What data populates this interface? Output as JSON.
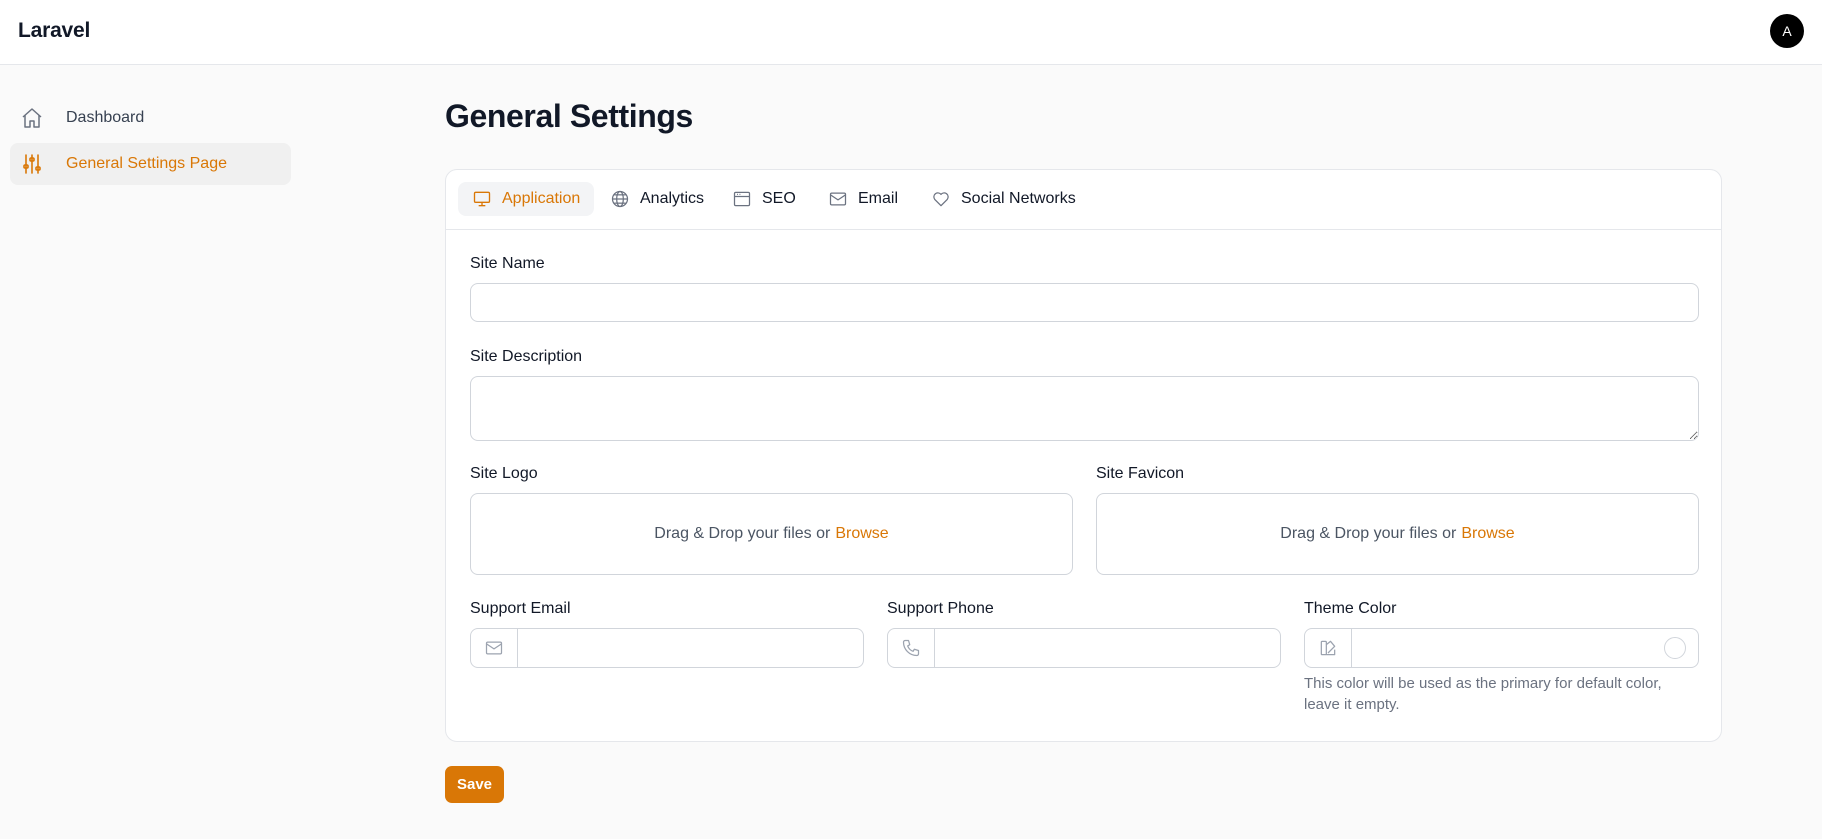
{
  "app": {
    "brand": "Laravel",
    "avatar_initial": "A"
  },
  "sidebar": {
    "items": [
      {
        "label": "Dashboard",
        "icon": "home-icon",
        "active": false
      },
      {
        "label": "General Settings Page",
        "icon": "sliders-icon",
        "active": true
      }
    ]
  },
  "page": {
    "title": "General Settings"
  },
  "tabs": [
    {
      "label": "Application",
      "icon": "monitor-icon",
      "active": true
    },
    {
      "label": "Analytics",
      "icon": "globe-icon",
      "active": false
    },
    {
      "label": "SEO",
      "icon": "browser-window-icon",
      "active": false
    },
    {
      "label": "Email",
      "icon": "envelope-icon",
      "active": false
    },
    {
      "label": "Social Networks",
      "icon": "heart-icon",
      "active": false
    }
  ],
  "form": {
    "site_name": {
      "label": "Site Name",
      "value": "",
      "placeholder": ""
    },
    "site_description": {
      "label": "Site Description",
      "value": "",
      "placeholder": ""
    },
    "site_logo": {
      "label": "Site Logo",
      "dropzone_text": "Drag & Drop your files or",
      "browse_label": "Browse"
    },
    "site_favicon": {
      "label": "Site Favicon",
      "dropzone_text": "Drag & Drop your files or",
      "browse_label": "Browse"
    },
    "support_email": {
      "label": "Support Email",
      "value": "",
      "icon": "envelope-icon"
    },
    "support_phone": {
      "label": "Support Phone",
      "value": "",
      "icon": "phone-icon"
    },
    "theme_color": {
      "label": "Theme Color",
      "value": "",
      "icon": "swatch-icon",
      "hint": "This color will be used as the primary for default color, leave it empty."
    }
  },
  "actions": {
    "save_label": "Save"
  },
  "colors": {
    "accent": "#d97706",
    "background": "#fafafa",
    "border": "#d1d5db",
    "text": "#111827"
  }
}
